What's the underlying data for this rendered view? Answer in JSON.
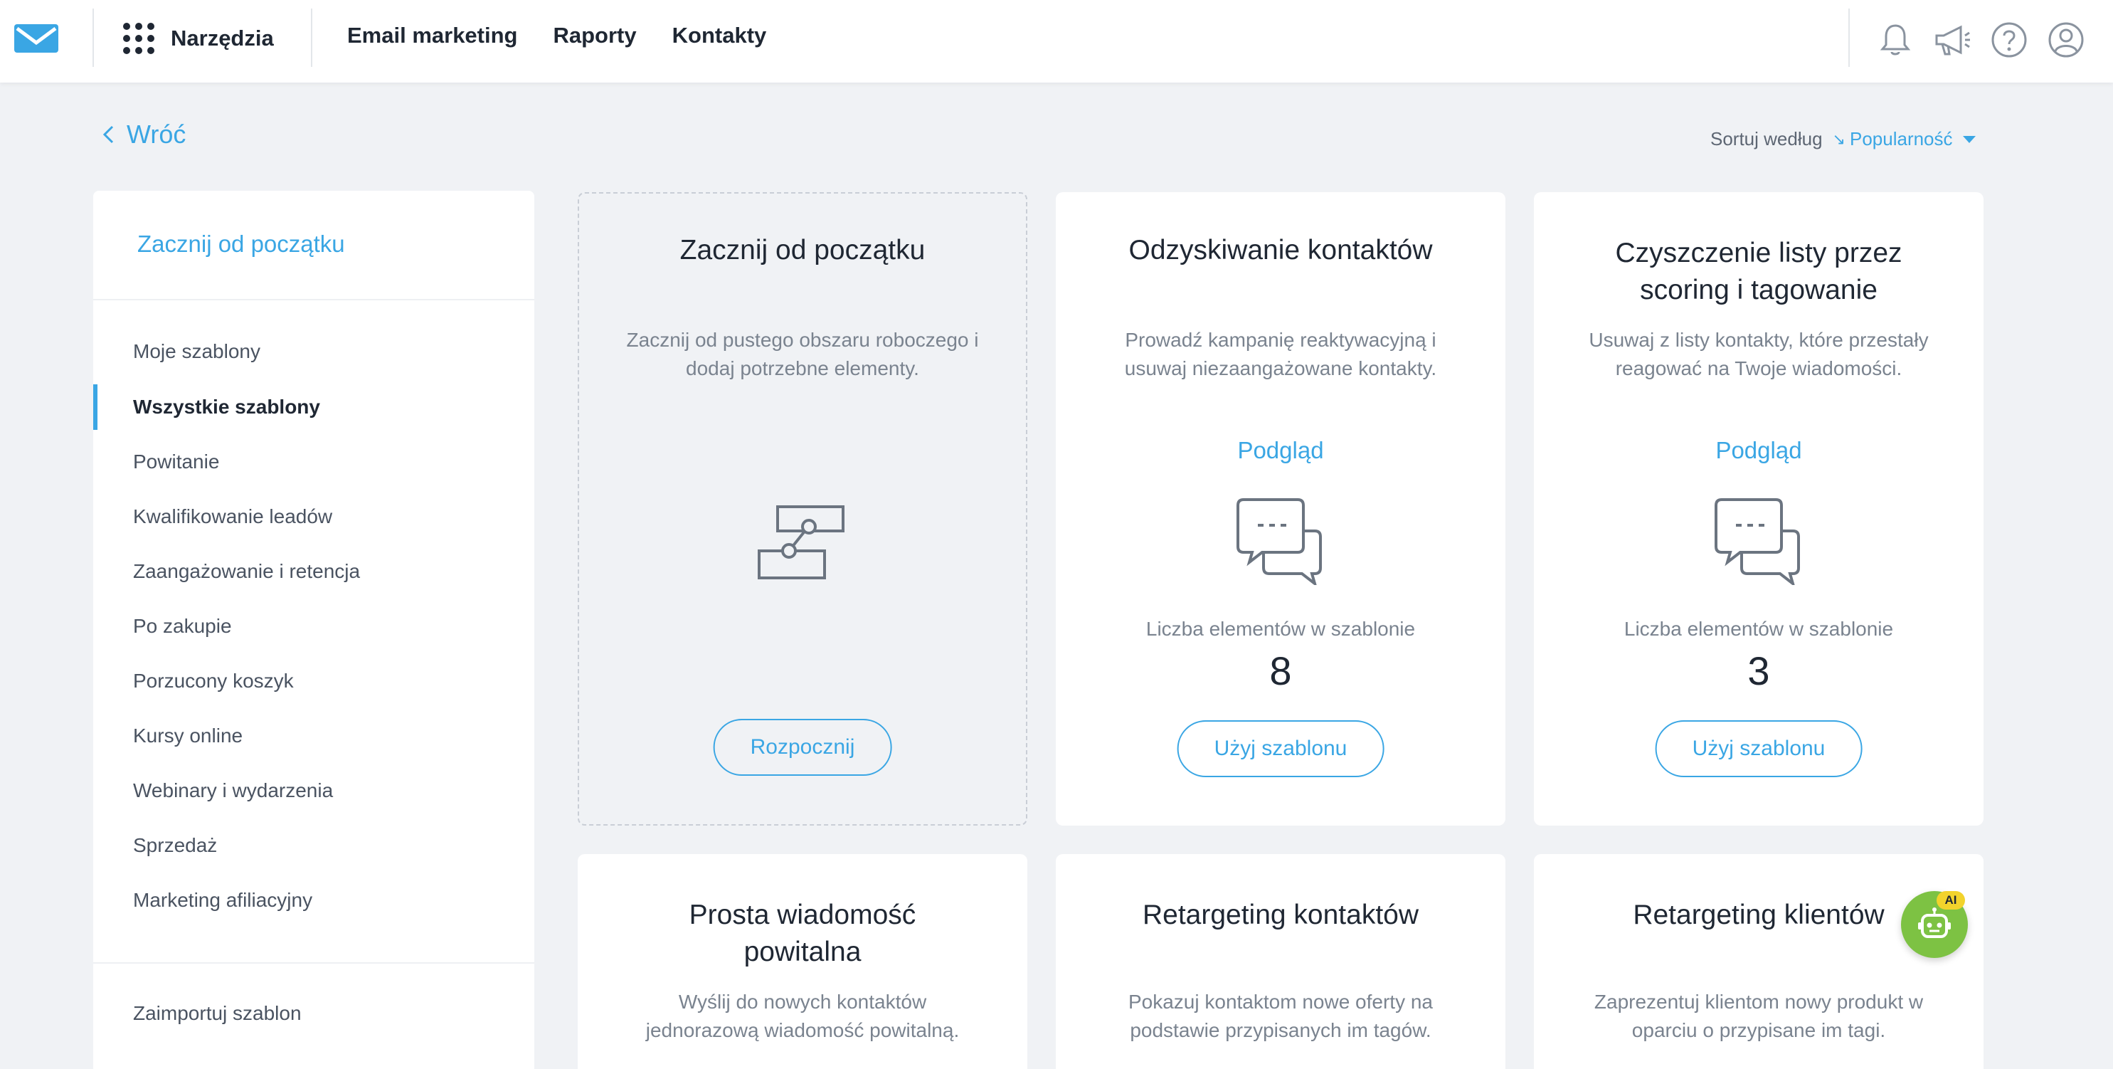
{
  "header": {
    "tools_label": "Narzędzia",
    "nav": [
      "Email marketing",
      "Raporty",
      "Kontakty"
    ],
    "accent_color": "#3aa6e4"
  },
  "back": {
    "label": "Wróć"
  },
  "sort": {
    "label": "Sortuj według",
    "value": "Popularność"
  },
  "sidebar": {
    "start_from_scratch": "Zacznij od początku",
    "items": [
      {
        "label": "Moje szablony",
        "active": false
      },
      {
        "label": "Wszystkie szablony",
        "active": true
      },
      {
        "label": "Powitanie",
        "active": false
      },
      {
        "label": "Kwalifikowanie leadów",
        "active": false
      },
      {
        "label": "Zaangażowanie i retencja",
        "active": false
      },
      {
        "label": "Po zakupie",
        "active": false
      },
      {
        "label": "Porzucony koszyk",
        "active": false
      },
      {
        "label": "Kursy online",
        "active": false
      },
      {
        "label": "Webinary i wydarzenia",
        "active": false
      },
      {
        "label": "Sprzedaż",
        "active": false
      },
      {
        "label": "Marketing afiliacyjny",
        "active": false
      }
    ],
    "import": "Zaimportuj szablon"
  },
  "cards": [
    {
      "title": "Zacznij od początku",
      "desc_line1": "Zacznij od pustego obszaru roboczego i",
      "desc_line2": "dodaj potrzebne elementy.",
      "button": "Rozpocznij"
    },
    {
      "title": "Odzyskiwanie kontaktów",
      "desc_line1": "Prowadź kampanię reaktywacyjną i",
      "desc_line2": "usuwaj niezaangażowane kontakty.",
      "preview": "Podgląd",
      "count_label": "Liczba elementów w szablonie",
      "count": "8",
      "button": "Użyj szablonu"
    },
    {
      "title_line1": "Czyszczenie listy przez",
      "title_line2": "scoring i tagowanie",
      "desc_line1": "Usuwaj z listy kontakty, które przestały",
      "desc_line2": "reagować na Twoje wiadomości.",
      "preview": "Podgląd",
      "count_label": "Liczba elementów w szablonie",
      "count": "3",
      "button": "Użyj szablonu"
    },
    {
      "title_line1": "Prosta wiadomość",
      "title_line2": "powitalna",
      "desc_line1": "Wyślij do nowych kontaktów",
      "desc_line2": "jednorazową wiadomość powitalną."
    },
    {
      "title": "Retargeting kontaktów",
      "desc_line1": "Pokazuj kontaktom nowe oferty na",
      "desc_line2": "podstawie przypisanych im tagów."
    },
    {
      "title": "Retargeting klientów",
      "desc_line1": "Zaprezentuj klientom nowy produkt w",
      "desc_line2": "oparciu o przypisane im tagi."
    }
  ],
  "ai_bot": {
    "badge": "AI"
  }
}
